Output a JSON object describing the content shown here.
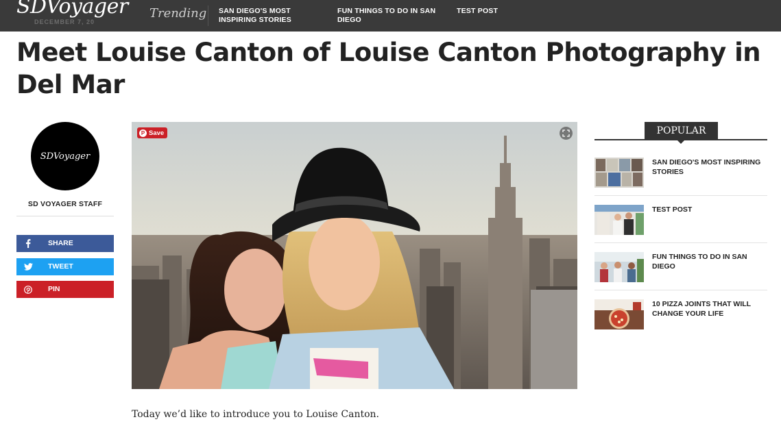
{
  "header": {
    "logo": "SDVoyager",
    "date_partial": "DECEMBER 7, 20",
    "trending_label": "Trending",
    "trending_links": [
      "SAN DIEGO'S MOST INSPIRING STORIES",
      "FUN THINGS TO DO IN SAN DIEGO",
      "TEST POST"
    ]
  },
  "article": {
    "title": "Meet Louise Canton of Louise Canton Photography in Del Mar",
    "intro": "Today we’d like to introduce you to Louise Canton."
  },
  "author": {
    "avatar_text": "SDVoyager",
    "name": "SD VOYAGER STAFF"
  },
  "share": {
    "facebook": "SHARE",
    "twitter": "TWEET",
    "pinterest": "PIN"
  },
  "photo": {
    "save_label": "Save"
  },
  "sidebar": {
    "popular_label": "POPULAR",
    "items": [
      {
        "title": "SAN DIEGO'S MOST INSPIRING STORIES"
      },
      {
        "title": "TEST POST"
      },
      {
        "title": "FUN THINGS TO DO IN SAN DIEGO"
      },
      {
        "title": "10 PIZZA JOINTS THAT WILL CHANGE YOUR LIFE"
      }
    ]
  },
  "colors": {
    "topbar": "#3a3a3a",
    "facebook": "#3c5a99",
    "twitter": "#1da1f2",
    "pinterest": "#cb2027"
  },
  "icons": [
    "facebook-icon",
    "twitter-icon",
    "pinterest-icon",
    "expand-icon"
  ]
}
